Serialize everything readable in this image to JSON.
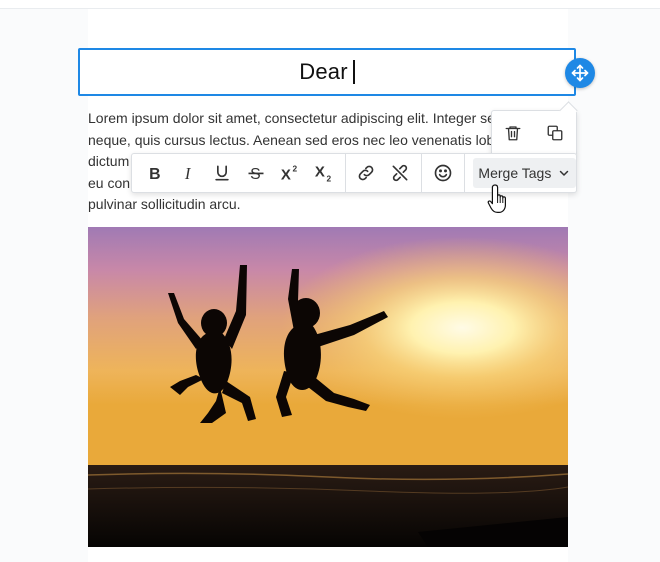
{
  "heading": {
    "text": "Dear"
  },
  "paragraph": {
    "lines": [
      "Lorem ipsum dolor sit amet, consectetur adipiscing elit. Integer se",
      "neque, quis cursus lectus. Aenean sed eros nec leo venenatis lob",
      "dictum",
      "eu con",
      "pulvinar sollicitudin arcu."
    ]
  },
  "toolbar": {
    "buttons": [
      {
        "name": "bold",
        "icon": "bold-icon"
      },
      {
        "name": "italic",
        "icon": "italic-icon"
      },
      {
        "name": "underline",
        "icon": "underline-icon"
      },
      {
        "name": "strikethrough",
        "icon": "strikethrough-icon"
      },
      {
        "name": "superscript",
        "icon": "superscript-icon"
      },
      {
        "name": "subscript",
        "icon": "subscript-icon"
      },
      {
        "name": "link",
        "icon": "link-icon"
      },
      {
        "name": "unlink",
        "icon": "unlink-icon"
      },
      {
        "name": "emoji",
        "icon": "emoji-icon"
      }
    ],
    "merge_tags_label": "Merge Tags"
  },
  "block_actions": [
    {
      "name": "delete",
      "icon": "trash-icon"
    },
    {
      "name": "duplicate",
      "icon": "duplicate-icon"
    }
  ],
  "colors": {
    "accent": "#1e88e5",
    "text": "#333333",
    "toolbar_border": "#dcdfe3",
    "merge_tags_bg": "#eef0f2"
  }
}
